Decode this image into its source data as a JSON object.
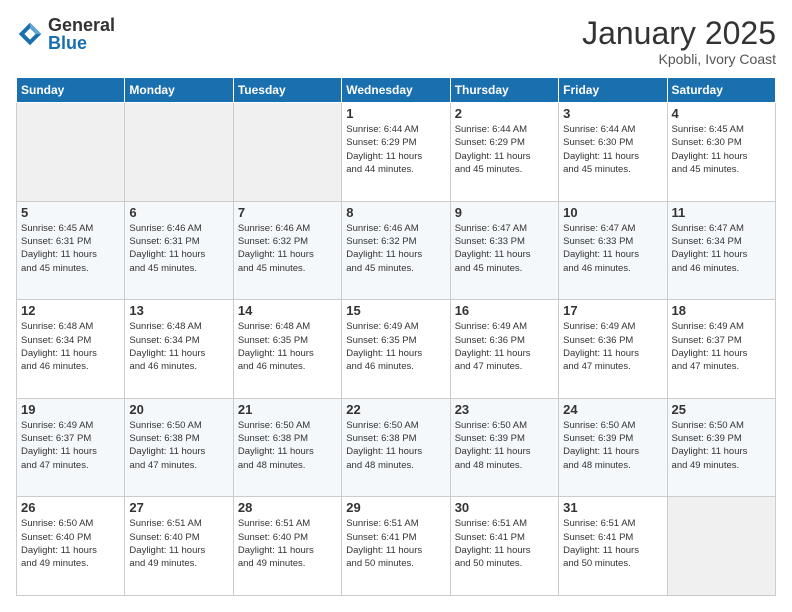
{
  "logo": {
    "general": "General",
    "blue": "Blue"
  },
  "title": {
    "main": "January 2025",
    "sub": "Kpobli, Ivory Coast"
  },
  "calendar": {
    "headers": [
      "Sunday",
      "Monday",
      "Tuesday",
      "Wednesday",
      "Thursday",
      "Friday",
      "Saturday"
    ],
    "weeks": [
      [
        {
          "day": "",
          "info": ""
        },
        {
          "day": "",
          "info": ""
        },
        {
          "day": "",
          "info": ""
        },
        {
          "day": "1",
          "info": "Sunrise: 6:44 AM\nSunset: 6:29 PM\nDaylight: 11 hours\nand 44 minutes."
        },
        {
          "day": "2",
          "info": "Sunrise: 6:44 AM\nSunset: 6:29 PM\nDaylight: 11 hours\nand 45 minutes."
        },
        {
          "day": "3",
          "info": "Sunrise: 6:44 AM\nSunset: 6:30 PM\nDaylight: 11 hours\nand 45 minutes."
        },
        {
          "day": "4",
          "info": "Sunrise: 6:45 AM\nSunset: 6:30 PM\nDaylight: 11 hours\nand 45 minutes."
        }
      ],
      [
        {
          "day": "5",
          "info": "Sunrise: 6:45 AM\nSunset: 6:31 PM\nDaylight: 11 hours\nand 45 minutes."
        },
        {
          "day": "6",
          "info": "Sunrise: 6:46 AM\nSunset: 6:31 PM\nDaylight: 11 hours\nand 45 minutes."
        },
        {
          "day": "7",
          "info": "Sunrise: 6:46 AM\nSunset: 6:32 PM\nDaylight: 11 hours\nand 45 minutes."
        },
        {
          "day": "8",
          "info": "Sunrise: 6:46 AM\nSunset: 6:32 PM\nDaylight: 11 hours\nand 45 minutes."
        },
        {
          "day": "9",
          "info": "Sunrise: 6:47 AM\nSunset: 6:33 PM\nDaylight: 11 hours\nand 45 minutes."
        },
        {
          "day": "10",
          "info": "Sunrise: 6:47 AM\nSunset: 6:33 PM\nDaylight: 11 hours\nand 46 minutes."
        },
        {
          "day": "11",
          "info": "Sunrise: 6:47 AM\nSunset: 6:34 PM\nDaylight: 11 hours\nand 46 minutes."
        }
      ],
      [
        {
          "day": "12",
          "info": "Sunrise: 6:48 AM\nSunset: 6:34 PM\nDaylight: 11 hours\nand 46 minutes."
        },
        {
          "day": "13",
          "info": "Sunrise: 6:48 AM\nSunset: 6:34 PM\nDaylight: 11 hours\nand 46 minutes."
        },
        {
          "day": "14",
          "info": "Sunrise: 6:48 AM\nSunset: 6:35 PM\nDaylight: 11 hours\nand 46 minutes."
        },
        {
          "day": "15",
          "info": "Sunrise: 6:49 AM\nSunset: 6:35 PM\nDaylight: 11 hours\nand 46 minutes."
        },
        {
          "day": "16",
          "info": "Sunrise: 6:49 AM\nSunset: 6:36 PM\nDaylight: 11 hours\nand 47 minutes."
        },
        {
          "day": "17",
          "info": "Sunrise: 6:49 AM\nSunset: 6:36 PM\nDaylight: 11 hours\nand 47 minutes."
        },
        {
          "day": "18",
          "info": "Sunrise: 6:49 AM\nSunset: 6:37 PM\nDaylight: 11 hours\nand 47 minutes."
        }
      ],
      [
        {
          "day": "19",
          "info": "Sunrise: 6:49 AM\nSunset: 6:37 PM\nDaylight: 11 hours\nand 47 minutes."
        },
        {
          "day": "20",
          "info": "Sunrise: 6:50 AM\nSunset: 6:38 PM\nDaylight: 11 hours\nand 47 minutes."
        },
        {
          "day": "21",
          "info": "Sunrise: 6:50 AM\nSunset: 6:38 PM\nDaylight: 11 hours\nand 48 minutes."
        },
        {
          "day": "22",
          "info": "Sunrise: 6:50 AM\nSunset: 6:38 PM\nDaylight: 11 hours\nand 48 minutes."
        },
        {
          "day": "23",
          "info": "Sunrise: 6:50 AM\nSunset: 6:39 PM\nDaylight: 11 hours\nand 48 minutes."
        },
        {
          "day": "24",
          "info": "Sunrise: 6:50 AM\nSunset: 6:39 PM\nDaylight: 11 hours\nand 48 minutes."
        },
        {
          "day": "25",
          "info": "Sunrise: 6:50 AM\nSunset: 6:39 PM\nDaylight: 11 hours\nand 49 minutes."
        }
      ],
      [
        {
          "day": "26",
          "info": "Sunrise: 6:50 AM\nSunset: 6:40 PM\nDaylight: 11 hours\nand 49 minutes."
        },
        {
          "day": "27",
          "info": "Sunrise: 6:51 AM\nSunset: 6:40 PM\nDaylight: 11 hours\nand 49 minutes."
        },
        {
          "day": "28",
          "info": "Sunrise: 6:51 AM\nSunset: 6:40 PM\nDaylight: 11 hours\nand 49 minutes."
        },
        {
          "day": "29",
          "info": "Sunrise: 6:51 AM\nSunset: 6:41 PM\nDaylight: 11 hours\nand 50 minutes."
        },
        {
          "day": "30",
          "info": "Sunrise: 6:51 AM\nSunset: 6:41 PM\nDaylight: 11 hours\nand 50 minutes."
        },
        {
          "day": "31",
          "info": "Sunrise: 6:51 AM\nSunset: 6:41 PM\nDaylight: 11 hours\nand 50 minutes."
        },
        {
          "day": "",
          "info": ""
        }
      ]
    ]
  }
}
